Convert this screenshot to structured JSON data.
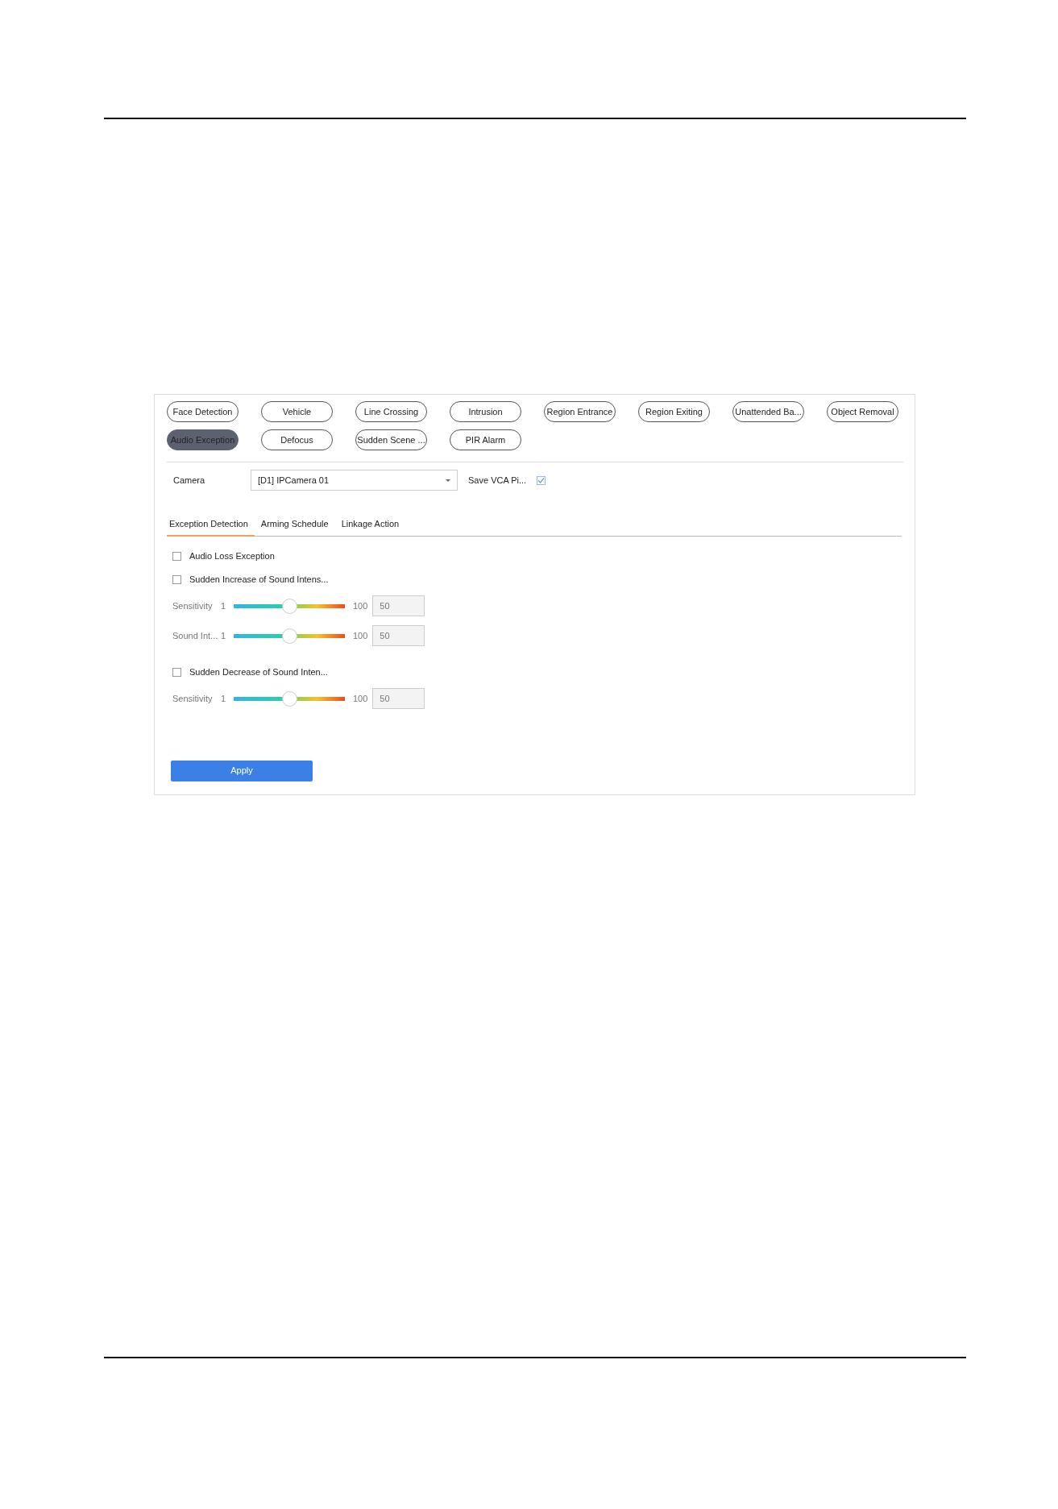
{
  "vca_types": [
    {
      "label": "Face Detection",
      "selected": false
    },
    {
      "label": "Vehicle",
      "selected": false
    },
    {
      "label": "Line Crossing",
      "selected": false
    },
    {
      "label": "Intrusion",
      "selected": false
    },
    {
      "label": "Region Entrance",
      "selected": false
    },
    {
      "label": "Region Exiting",
      "selected": false
    },
    {
      "label": "Unattended Ba...",
      "selected": false
    },
    {
      "label": "Object Removal",
      "selected": false
    },
    {
      "label": "Audio Exception",
      "selected": true
    },
    {
      "label": "Defocus",
      "selected": false
    },
    {
      "label": "Sudden Scene ...",
      "selected": false
    },
    {
      "label": "PIR Alarm",
      "selected": false
    }
  ],
  "camera": {
    "label": "Camera",
    "value": "[D1] IPCamera 01"
  },
  "save_vca": {
    "label": "Save VCA Pi...",
    "checked": true
  },
  "tabs": [
    {
      "label": "Exception Detection",
      "selected": true
    },
    {
      "label": "Arming Schedule",
      "selected": false
    },
    {
      "label": "Linkage Action",
      "selected": false
    }
  ],
  "options": [
    {
      "kind": "checkbox",
      "label": "Audio Loss Exception",
      "checked": false
    },
    {
      "kind": "checkbox",
      "label": "Sudden Increase of Sound Intens...",
      "checked": false
    },
    {
      "kind": "slider",
      "label": "Sensitivity",
      "min": "1",
      "max": "100",
      "level": 0.5,
      "value": "50"
    },
    {
      "kind": "slider",
      "label": "Sound Int...",
      "min": "1",
      "max": "100",
      "level": 0.5,
      "value": "50"
    },
    {
      "kind": "gap"
    },
    {
      "kind": "checkbox",
      "label": "Sudden Decrease of Sound Inten...",
      "checked": false
    },
    {
      "kind": "slider",
      "label": "Sensitivity",
      "min": "1",
      "max": "100",
      "level": 0.5,
      "value": "50"
    }
  ],
  "apply_button": "Apply"
}
